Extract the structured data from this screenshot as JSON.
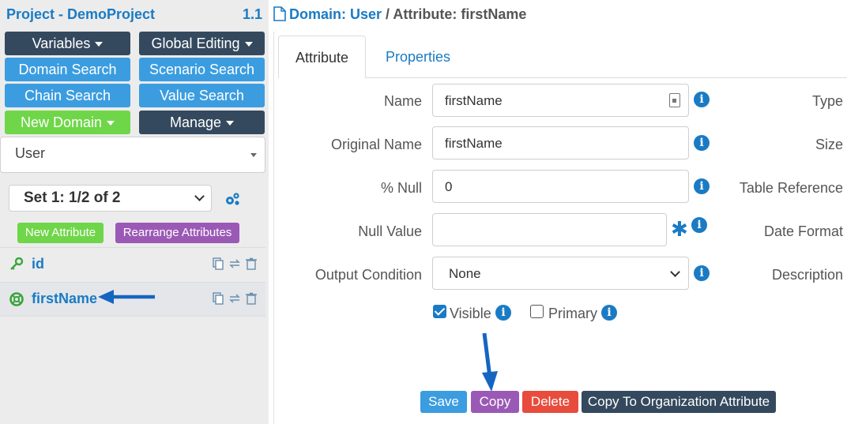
{
  "project": {
    "title": "Project - DemoProject",
    "version": "1.1"
  },
  "breadcrumb": {
    "domain": "Domain: User",
    "separator": "/",
    "attribute": "Attribute: firstName"
  },
  "sidebar": {
    "buttons": {
      "variables": "Variables",
      "global_editing": "Global Editing",
      "domain_search": "Domain Search",
      "scenario_search": "Scenario Search",
      "chain_search": "Chain Search",
      "value_search": "Value Search",
      "new_domain": "New Domain",
      "manage": "Manage"
    },
    "domain_select": "User",
    "set_select": "Set 1: 1/2 of 2",
    "new_attribute": "New Attribute",
    "rearrange_attributes": "Rearrange Attributes",
    "attributes": [
      {
        "name": "id",
        "icon": "key-icon"
      },
      {
        "name": "firstName",
        "icon": "lifebuoy-icon",
        "selected": true
      }
    ]
  },
  "tabs": {
    "attribute": "Attribute",
    "properties": "Properties"
  },
  "form": {
    "name": {
      "label": "Name",
      "value": "firstName"
    },
    "original_name": {
      "label": "Original Name",
      "value": "firstName"
    },
    "percent_null": {
      "label": "% Null",
      "value": "0"
    },
    "null_value": {
      "label": "Null Value",
      "value": ""
    },
    "output_condition": {
      "label": "Output Condition",
      "value": "None"
    },
    "visible": {
      "label": "Visible",
      "checked": true
    },
    "primary": {
      "label": "Primary",
      "checked": false
    }
  },
  "right_labels": {
    "type": "Type",
    "size": "Size",
    "table_reference": "Table Reference",
    "date_format": "Date Format",
    "description": "Description"
  },
  "actions": {
    "save": "Save",
    "copy": "Copy",
    "delete": "Delete",
    "copy_org": "Copy To Organization Attribute"
  },
  "colors": {
    "primary_blue": "#1a7bc4",
    "dark": "#34495e",
    "button_blue": "#3b9de0",
    "green": "#6fd649",
    "purple": "#9b59b6",
    "red": "#e74c3c",
    "annotation_arrow": "#1565c0"
  }
}
